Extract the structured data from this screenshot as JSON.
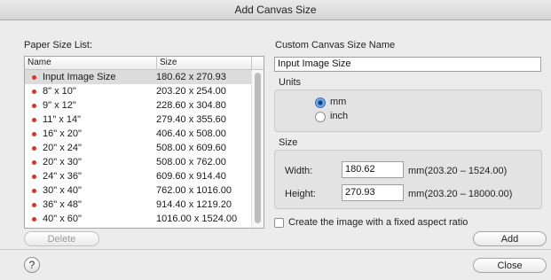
{
  "window": {
    "title": "Add Canvas Size"
  },
  "paper_list": {
    "label": "Paper Size List:",
    "header": {
      "name": "Name",
      "size": "Size"
    },
    "rows": [
      {
        "name": "Input Image Size",
        "size": "180.62 x 270.93",
        "selected": true
      },
      {
        "name": "8\" x 10\"",
        "size": "203.20 x 254.00"
      },
      {
        "name": "9\" x 12\"",
        "size": "228.60 x 304.80"
      },
      {
        "name": "11\" x 14\"",
        "size": "279.40 x 355.60"
      },
      {
        "name": "16\" x 20\"",
        "size": "406.40 x 508.00"
      },
      {
        "name": "20\" x 24\"",
        "size": "508.00 x 609.60"
      },
      {
        "name": "20\" x 30\"",
        "size": "508.00 x 762.00"
      },
      {
        "name": "24\" x 36\"",
        "size": "609.60 x 914.40"
      },
      {
        "name": "30\" x 40\"",
        "size": "762.00 x 1016.00"
      },
      {
        "name": "36\" x 48\"",
        "size": "914.40 x 1219.20"
      },
      {
        "name": "40\" x 60\"",
        "size": "1016.00 x 1524.00"
      }
    ],
    "delete_label": "Delete"
  },
  "custom": {
    "label": "Custom Canvas Size Name",
    "name_value": "Input Image Size"
  },
  "units": {
    "label": "Units",
    "options": [
      "mm",
      "inch"
    ],
    "selected": "mm"
  },
  "size": {
    "label": "Size",
    "width_label": "Width:",
    "width_value": "180.62",
    "width_range": "mm(203.20 – 1524.00)",
    "height_label": "Height:",
    "height_value": "270.93",
    "height_range": "mm(203.20 – 18000.00)"
  },
  "aspect": {
    "label": "Create the image with a fixed aspect ratio",
    "checked": false
  },
  "buttons": {
    "add": "Add",
    "close": "Close",
    "help": "?"
  },
  "colors": {
    "bullet": "#d8342c",
    "selected_row": "#dcdcdc",
    "radio_accent": "#5ea0e8"
  }
}
